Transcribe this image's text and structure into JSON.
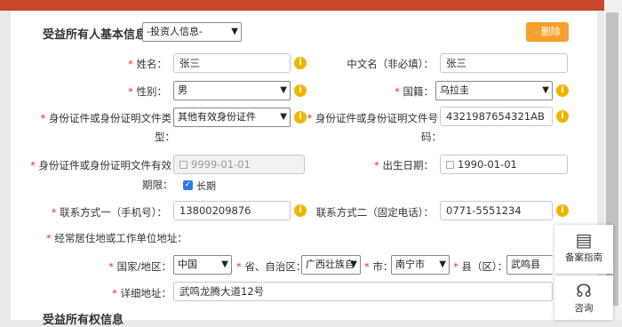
{
  "section": {
    "title": "受益所有人基本信息",
    "investor_select": "-投资人信息-",
    "delete_label": "- 删除",
    "next_title": "受益所有权信息"
  },
  "fields": {
    "name": {
      "label": "姓名：",
      "value": "张三"
    },
    "cn_name": {
      "label": "中文名（非必填）：",
      "value": "张三"
    },
    "gender": {
      "label": "性别：",
      "value": "男"
    },
    "nationality": {
      "label": "国籍：",
      "value": "乌拉圭"
    },
    "id_type": {
      "label_line1": "身份证件或身份证明文件类",
      "label_line2": "型：",
      "value": "其他有效身份证件"
    },
    "id_number": {
      "label_line1": "身份证件或身份证明文件号",
      "label_line2": "码：",
      "value": "4321987654321AB"
    },
    "id_validity": {
      "label_line1": "身份证件或身份证明文件有效",
      "label_line2": "期限：",
      "value": "9999-01-01",
      "long_term": "长期"
    },
    "birth_date": {
      "label": "出生日期：",
      "value": "1990-01-01"
    },
    "contact1": {
      "label": "联系方式一（手机号）：",
      "value": "13800209876"
    },
    "contact2": {
      "label": "联系方式二（固定电话）：",
      "value": "0771-5551234"
    },
    "address_title": "经常居住地或工作单位地址：",
    "country": {
      "label": "国家/地区：",
      "value": "中国"
    },
    "province": {
      "label": "省、自治区：",
      "value": "广西壮族自"
    },
    "city": {
      "label": "市：",
      "value": "南宁市"
    },
    "county": {
      "label": "县（区）：",
      "value": "武鸣县"
    },
    "detail": {
      "label": "详细地址：",
      "value": "武鸣龙腾大道12号"
    }
  },
  "float_panel": {
    "guide": "备案指南",
    "consult": "咨询"
  },
  "colors": {
    "required": "#e5322d",
    "info": "#f0b400",
    "delete_button": "#f5a02a",
    "checkbox": "#2d7be5"
  }
}
